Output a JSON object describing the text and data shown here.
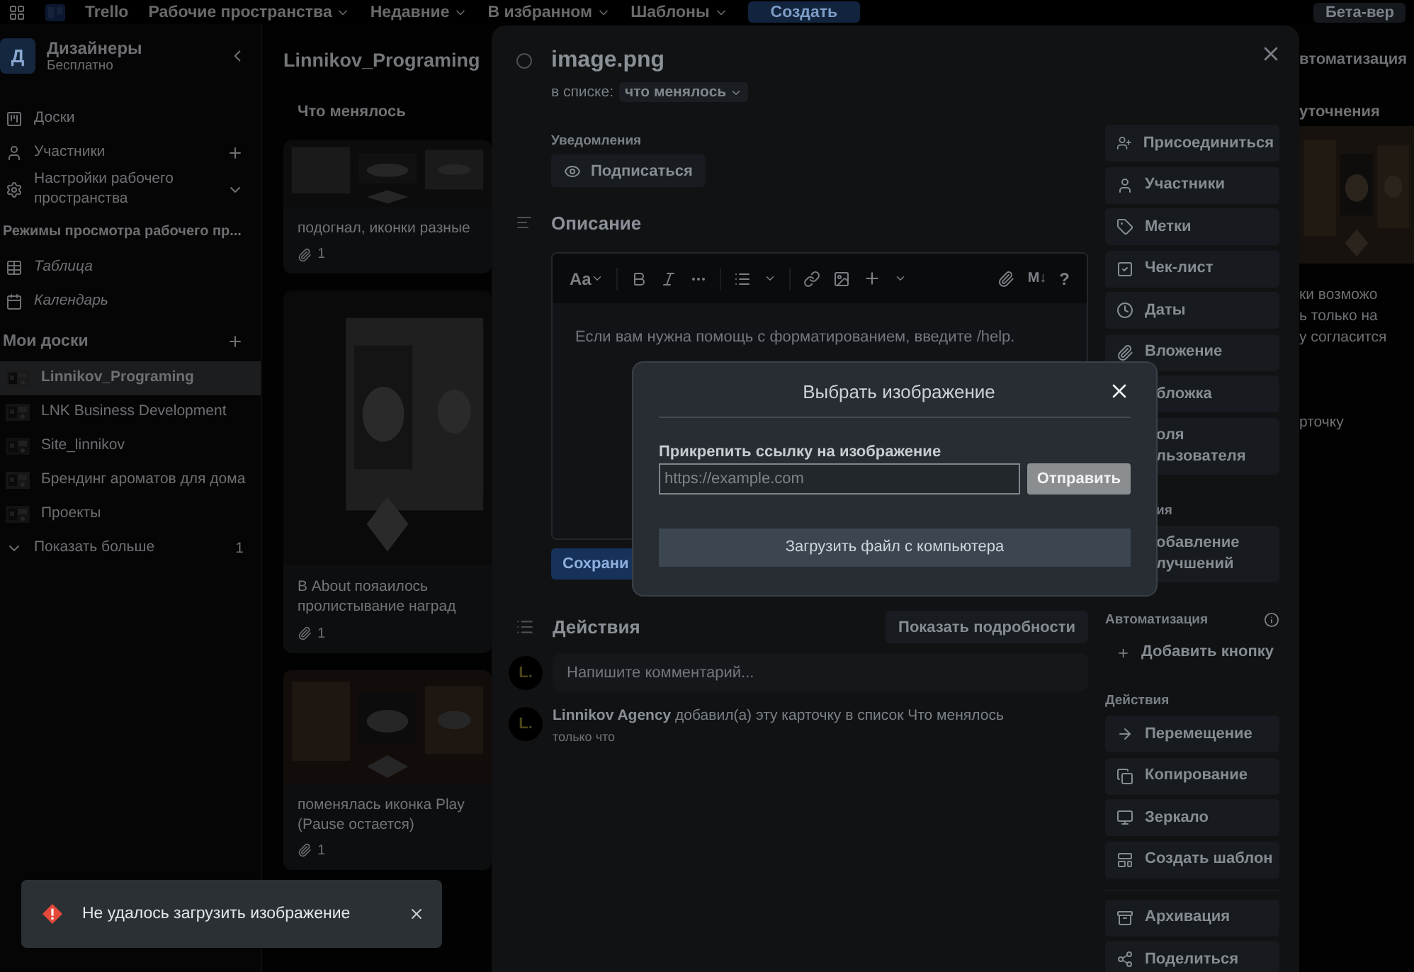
{
  "top_bar": {
    "logo": "Trello",
    "menus": [
      {
        "label": "Рабочие пространства"
      },
      {
        "label": "Недавние"
      },
      {
        "label": "В избранном"
      },
      {
        "label": "Шаблоны"
      }
    ],
    "create": "Создать",
    "beta": "Бета-вер"
  },
  "sidebar": {
    "workspace": {
      "initial": "Д",
      "name": "Дизайнеры",
      "plan": "Бесплатно"
    },
    "nav": [
      {
        "label": "Доски",
        "kind": "link"
      },
      {
        "label": "Участники",
        "kind": "add"
      },
      {
        "label": "Настройки рабочего пространства",
        "kind": "expand"
      }
    ],
    "views_title": "Режимы просмотра рабочего пр...",
    "views": [
      {
        "label": "Таблица"
      },
      {
        "label": "Календарь"
      }
    ],
    "boards_title": "Мои доски",
    "boards": [
      {
        "label": "Linnikov_Programing",
        "selected": true
      },
      {
        "label": "LNK Business Development",
        "selected": false
      },
      {
        "label": "Site_linnikov",
        "selected": false
      },
      {
        "label": "Брендинг ароматов для дома",
        "selected": false
      },
      {
        "label": "Проекты",
        "selected": false
      }
    ],
    "show_more": {
      "label": "Показать больше",
      "count": "1"
    }
  },
  "board": {
    "title": "Linnikov_Programing",
    "right_menu": "втоматизация",
    "lists": [
      {
        "title": "Что менялось",
        "cards": [
          {
            "title": "подогнал, иконки разные",
            "attachments": "1"
          },
          {
            "title": "В About пояаилось пролистывание наград",
            "attachments": "1"
          },
          {
            "title": "поменялась иконка Play (Pause остается)",
            "attachments": "1"
          }
        ]
      }
    ],
    "side_list": {
      "title": "уточнения",
      "text_lines": [
        "ки возможо",
        "ь только на",
        "у согласится"
      ],
      "footer": "рточку"
    }
  },
  "card": {
    "title": "image.png",
    "list_prefix": "в списке:",
    "list_name": "что менялось",
    "notifications_label": "Уведомления",
    "watch": "Подписаться",
    "description_title": "Описание",
    "editor": {
      "text_style": "Aa",
      "markdown": "M↓",
      "help": "?",
      "placeholder": "Если вам нужна помощь с форматированием, введите /help."
    },
    "save": "Сохрани",
    "activity_title": "Действия",
    "details": "Показать подробности",
    "comment": {
      "avatar": "L.",
      "placeholder": "Напишите комментарий..."
    },
    "events": [
      {
        "avatar": "L.",
        "text": "**Linnikov Agency** добавил(а) эту карточку в список Что менялось",
        "time": "только что"
      }
    ],
    "sidebar": [
      {
        "kind": "plain",
        "items": [
          {
            "kind": "button",
            "lines": [
              "Присоединиться"
            ]
          },
          {
            "kind": "button",
            "lines": [
              "Участники"
            ]
          },
          {
            "kind": "button",
            "lines": [
              "Метки"
            ]
          },
          {
            "kind": "button",
            "lines": [
              "Чек-лист"
            ]
          },
          {
            "kind": "button",
            "lines": [
              "Даты"
            ]
          },
          {
            "kind": "button",
            "lines": [
              "Вложение"
            ]
          },
          {
            "kind": "cut",
            "lines": [
              "бложка"
            ]
          },
          {
            "kind": "cut",
            "lines": [
              "оля",
              "льзователя"
            ]
          }
        ]
      },
      {
        "kind": "cut",
        "title": "ия",
        "items": [
          {
            "kind": "cut",
            "lines": [
              "обавление",
              "лучшений"
            ]
          }
        ]
      },
      {
        "kind": "info",
        "title": "Автоматизация",
        "items": [
          {
            "kind": "add",
            "lines": [
              "Добавить кнопку"
            ]
          }
        ]
      },
      {
        "kind": "plain",
        "title": "Действия",
        "items": [
          {
            "kind": "button",
            "lines": [
              "Перемещение"
            ]
          },
          {
            "kind": "button",
            "lines": [
              "Копирование"
            ]
          },
          {
            "kind": "button",
            "lines": [
              "Зеркало"
            ]
          },
          {
            "kind": "button",
            "lines": [
              "Создать шаблон"
            ]
          }
        ]
      },
      {
        "kind": "ruled",
        "items": [
          {
            "kind": "button",
            "lines": [
              "Архивация"
            ]
          },
          {
            "kind": "button",
            "lines": [
              "Поделиться"
            ]
          }
        ]
      }
    ]
  },
  "dialog": {
    "title": "Выбрать изображение",
    "link_label": "Прикрепить ссылку на изображение",
    "placeholder": "https://example.com",
    "submit": "Отправить",
    "upload": "Загрузить файл с компьютера"
  },
  "toast": {
    "message": "Не удалось загрузить изображение"
  }
}
